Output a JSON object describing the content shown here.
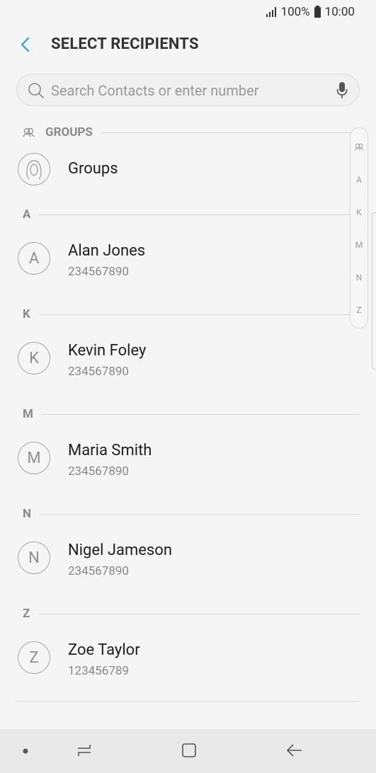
{
  "status_bar": {
    "battery": "100%",
    "time": "10:00"
  },
  "header": {
    "title": "SELECT RECIPIENTS"
  },
  "search": {
    "placeholder": "Search Contacts or enter number"
  },
  "groups_section": {
    "label": "GROUPS",
    "item_label": "Groups"
  },
  "sections": [
    {
      "letter": "A",
      "contacts": [
        {
          "initial": "A",
          "name": "Alan Jones",
          "number": "234567890"
        }
      ]
    },
    {
      "letter": "K",
      "contacts": [
        {
          "initial": "K",
          "name": "Kevin Foley",
          "number": "234567890"
        }
      ]
    },
    {
      "letter": "M",
      "contacts": [
        {
          "initial": "M",
          "name": "Maria Smith",
          "number": "234567890"
        }
      ]
    },
    {
      "letter": "N",
      "contacts": [
        {
          "initial": "N",
          "name": "Nigel Jameson",
          "number": "234567890"
        }
      ]
    },
    {
      "letter": "Z",
      "contacts": [
        {
          "initial": "Z",
          "name": "Zoe Taylor",
          "number": "123456789"
        }
      ]
    }
  ],
  "index_bar": {
    "letters": [
      "A",
      "K",
      "M",
      "N",
      "Z"
    ]
  },
  "colors": {
    "accent": "#3aa6c4",
    "text": "#202020",
    "muted": "#888888"
  }
}
